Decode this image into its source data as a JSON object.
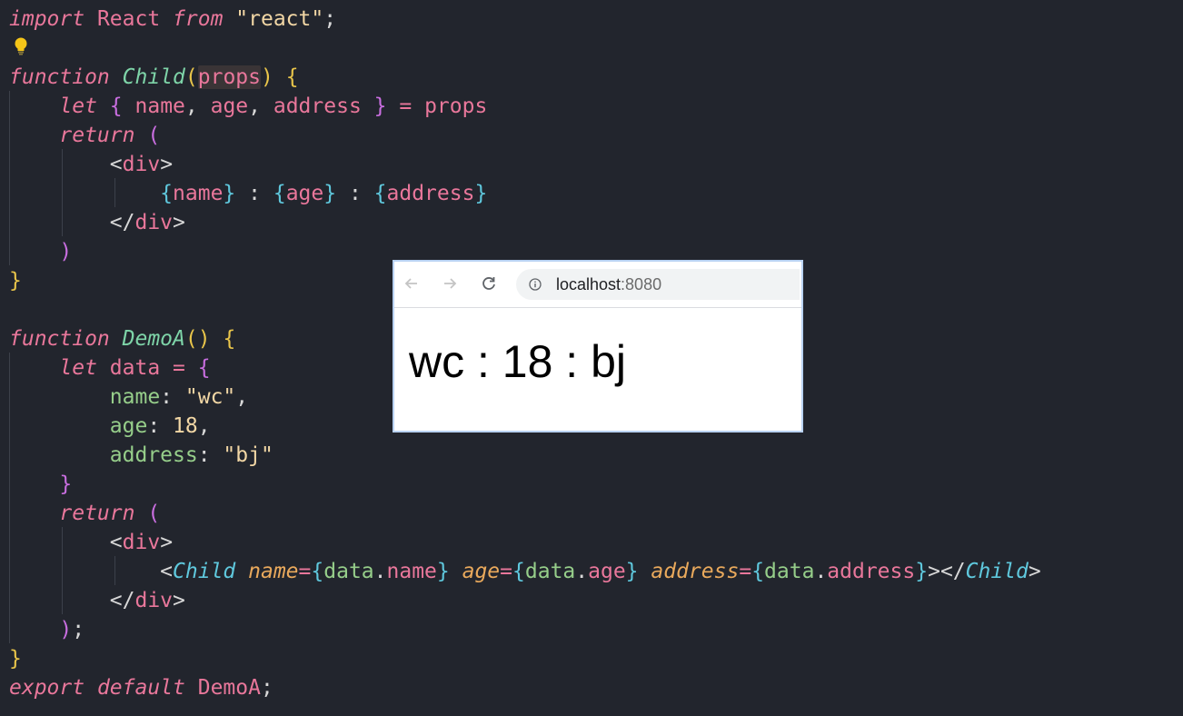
{
  "editor": {
    "lines": [
      {
        "tokens": [
          {
            "t": "import",
            "c": "kw-i"
          },
          {
            "t": " React ",
            "c": "plain"
          },
          {
            "t": "from",
            "c": "kw-i"
          },
          {
            "t": " ",
            "c": "plain"
          },
          {
            "t": "\"react\"",
            "c": "str"
          },
          {
            "t": ";",
            "c": "punc"
          }
        ]
      },
      {
        "tokens": []
      },
      {
        "tokens": [
          {
            "t": "function",
            "c": "kw-i"
          },
          {
            "t": " ",
            "c": "plain"
          },
          {
            "t": "Child",
            "c": "fn-i"
          },
          {
            "t": "(",
            "c": "brace-y"
          },
          {
            "t": "props",
            "c": "var hl"
          },
          {
            "t": ")",
            "c": "brace-y"
          },
          {
            "t": " ",
            "c": "plain"
          },
          {
            "t": "{",
            "c": "brace-y"
          }
        ]
      },
      {
        "tokens": [
          {
            "t": "    ",
            "c": "plain"
          },
          {
            "t": "let",
            "c": "kw-i"
          },
          {
            "t": " ",
            "c": "plain"
          },
          {
            "t": "{",
            "c": "brace-p"
          },
          {
            "t": " name",
            "c": "var"
          },
          {
            "t": ",",
            "c": "punc"
          },
          {
            "t": " age",
            "c": "var"
          },
          {
            "t": ",",
            "c": "punc"
          },
          {
            "t": " address ",
            "c": "var"
          },
          {
            "t": "}",
            "c": "brace-p"
          },
          {
            "t": " ",
            "c": "plain"
          },
          {
            "t": "=",
            "c": "var"
          },
          {
            "t": " props",
            "c": "var"
          }
        ]
      },
      {
        "tokens": [
          {
            "t": "    ",
            "c": "plain"
          },
          {
            "t": "return",
            "c": "kw-i"
          },
          {
            "t": " ",
            "c": "plain"
          },
          {
            "t": "(",
            "c": "brace-p"
          }
        ]
      },
      {
        "tokens": [
          {
            "t": "        ",
            "c": "plain"
          },
          {
            "t": "<",
            "c": "jsx-tag"
          },
          {
            "t": "div",
            "c": "jsx-name"
          },
          {
            "t": ">",
            "c": "jsx-tag"
          }
        ]
      },
      {
        "tokens": [
          {
            "t": "            ",
            "c": "plain"
          },
          {
            "t": "{",
            "c": "brace-c"
          },
          {
            "t": "name",
            "c": "var"
          },
          {
            "t": "}",
            "c": "brace-c"
          },
          {
            "t": " : ",
            "c": "punc"
          },
          {
            "t": "{",
            "c": "brace-c"
          },
          {
            "t": "age",
            "c": "var"
          },
          {
            "t": "}",
            "c": "brace-c"
          },
          {
            "t": " : ",
            "c": "punc"
          },
          {
            "t": "{",
            "c": "brace-c"
          },
          {
            "t": "address",
            "c": "var"
          },
          {
            "t": "}",
            "c": "brace-c"
          }
        ]
      },
      {
        "tokens": [
          {
            "t": "        ",
            "c": "plain"
          },
          {
            "t": "</",
            "c": "jsx-tag"
          },
          {
            "t": "div",
            "c": "jsx-name"
          },
          {
            "t": ">",
            "c": "jsx-tag"
          }
        ]
      },
      {
        "tokens": [
          {
            "t": "    ",
            "c": "plain"
          },
          {
            "t": ")",
            "c": "brace-p"
          }
        ]
      },
      {
        "tokens": [
          {
            "t": "}",
            "c": "brace-y"
          }
        ]
      },
      {
        "tokens": []
      },
      {
        "tokens": [
          {
            "t": "function",
            "c": "kw-i"
          },
          {
            "t": " ",
            "c": "plain"
          },
          {
            "t": "DemoA",
            "c": "fn-i"
          },
          {
            "t": "()",
            "c": "brace-y"
          },
          {
            "t": " ",
            "c": "plain"
          },
          {
            "t": "{",
            "c": "brace-y"
          }
        ]
      },
      {
        "tokens": [
          {
            "t": "    ",
            "c": "plain"
          },
          {
            "t": "let",
            "c": "kw-i"
          },
          {
            "t": " data ",
            "c": "var"
          },
          {
            "t": "=",
            "c": "var"
          },
          {
            "t": " ",
            "c": "plain"
          },
          {
            "t": "{",
            "c": "brace-p"
          }
        ]
      },
      {
        "tokens": [
          {
            "t": "        ",
            "c": "plain"
          },
          {
            "t": "name",
            "c": "prop"
          },
          {
            "t": ": ",
            "c": "punc"
          },
          {
            "t": "\"wc\"",
            "c": "str"
          },
          {
            "t": ",",
            "c": "punc"
          }
        ]
      },
      {
        "tokens": [
          {
            "t": "        ",
            "c": "plain"
          },
          {
            "t": "age",
            "c": "prop"
          },
          {
            "t": ": ",
            "c": "punc"
          },
          {
            "t": "18",
            "c": "num"
          },
          {
            "t": ",",
            "c": "punc"
          }
        ]
      },
      {
        "tokens": [
          {
            "t": "        ",
            "c": "plain"
          },
          {
            "t": "address",
            "c": "prop"
          },
          {
            "t": ": ",
            "c": "punc"
          },
          {
            "t": "\"bj\"",
            "c": "str"
          }
        ]
      },
      {
        "tokens": [
          {
            "t": "    ",
            "c": "plain"
          },
          {
            "t": "}",
            "c": "brace-p"
          }
        ]
      },
      {
        "tokens": [
          {
            "t": "    ",
            "c": "plain"
          },
          {
            "t": "return",
            "c": "kw-i"
          },
          {
            "t": " ",
            "c": "plain"
          },
          {
            "t": "(",
            "c": "brace-p"
          }
        ]
      },
      {
        "tokens": [
          {
            "t": "        ",
            "c": "plain"
          },
          {
            "t": "<",
            "c": "jsx-tag"
          },
          {
            "t": "div",
            "c": "jsx-name"
          },
          {
            "t": ">",
            "c": "jsx-tag"
          }
        ]
      },
      {
        "tokens": [
          {
            "t": "            ",
            "c": "plain"
          },
          {
            "t": "<",
            "c": "jsx-tag"
          },
          {
            "t": "Child",
            "c": "tag-i"
          },
          {
            "t": " ",
            "c": "plain"
          },
          {
            "t": "name",
            "c": "attr-i"
          },
          {
            "t": "=",
            "c": "var"
          },
          {
            "t": "{",
            "c": "brace-c"
          },
          {
            "t": "data",
            "c": "prop"
          },
          {
            "t": ".",
            "c": "punc"
          },
          {
            "t": "name",
            "c": "var"
          },
          {
            "t": "}",
            "c": "brace-c"
          },
          {
            "t": " ",
            "c": "plain"
          },
          {
            "t": "age",
            "c": "attr-i"
          },
          {
            "t": "=",
            "c": "var"
          },
          {
            "t": "{",
            "c": "brace-c"
          },
          {
            "t": "data",
            "c": "prop"
          },
          {
            "t": ".",
            "c": "punc"
          },
          {
            "t": "age",
            "c": "var"
          },
          {
            "t": "}",
            "c": "brace-c"
          },
          {
            "t": " ",
            "c": "plain"
          },
          {
            "t": "address",
            "c": "attr-i"
          },
          {
            "t": "=",
            "c": "var"
          },
          {
            "t": "{",
            "c": "brace-c"
          },
          {
            "t": "data",
            "c": "prop"
          },
          {
            "t": ".",
            "c": "punc"
          },
          {
            "t": "address",
            "c": "var"
          },
          {
            "t": "}",
            "c": "brace-c"
          },
          {
            "t": "></",
            "c": "jsx-tag"
          },
          {
            "t": "Child",
            "c": "tag-i"
          },
          {
            "t": ">",
            "c": "jsx-tag"
          }
        ]
      },
      {
        "tokens": [
          {
            "t": "        ",
            "c": "plain"
          },
          {
            "t": "</",
            "c": "jsx-tag"
          },
          {
            "t": "div",
            "c": "jsx-name"
          },
          {
            "t": ">",
            "c": "jsx-tag"
          }
        ]
      },
      {
        "tokens": [
          {
            "t": "    ",
            "c": "plain"
          },
          {
            "t": ")",
            "c": "brace-p"
          },
          {
            "t": ";",
            "c": "punc"
          }
        ]
      },
      {
        "tokens": [
          {
            "t": "}",
            "c": "brace-y"
          }
        ]
      },
      {
        "tokens": [
          {
            "t": "export",
            "c": "kw-i"
          },
          {
            "t": " ",
            "c": "plain"
          },
          {
            "t": "default",
            "c": "kw-i"
          },
          {
            "t": " DemoA",
            "c": "plain"
          },
          {
            "t": ";",
            "c": "punc"
          }
        ]
      }
    ]
  },
  "browser": {
    "back_icon": "arrow-left-icon",
    "forward_icon": "arrow-right-icon",
    "reload_icon": "reload-icon",
    "info_icon": "info-icon",
    "url_host": "localhost",
    "url_port": ":8080",
    "page_text": "wc : 18 : bj"
  }
}
